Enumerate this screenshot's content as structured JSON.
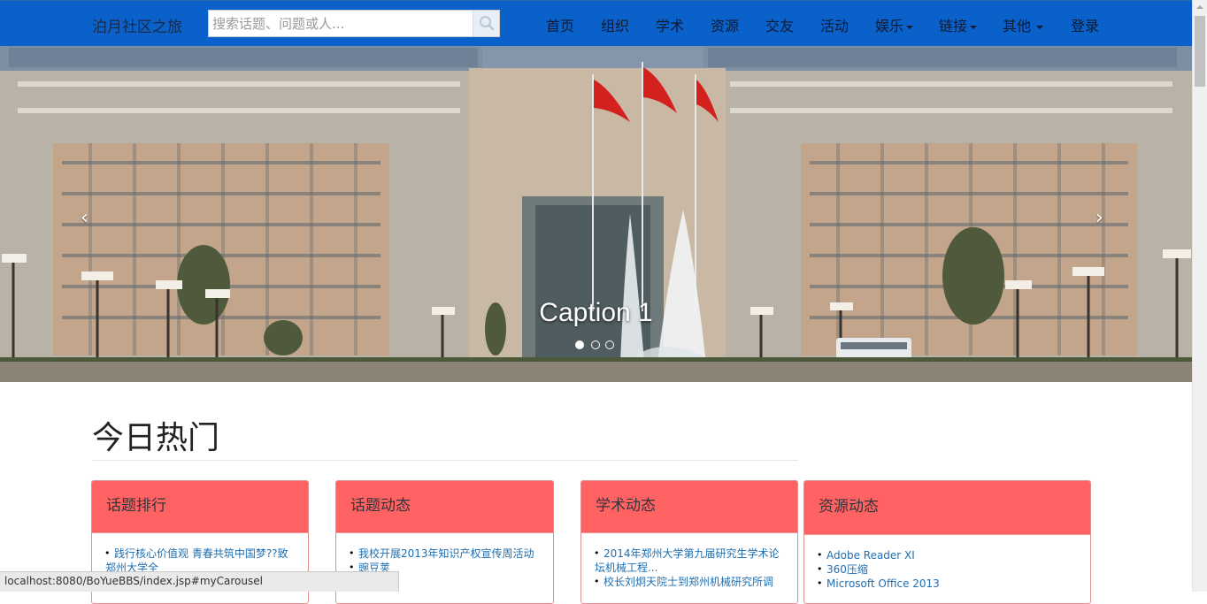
{
  "navbar": {
    "brand": "泊月社区之旅",
    "search_placeholder": "搜索话题、问题或人...",
    "items": [
      {
        "label": "首页",
        "dropdown": false
      },
      {
        "label": "组织",
        "dropdown": false
      },
      {
        "label": "学术",
        "dropdown": false
      },
      {
        "label": "资源",
        "dropdown": false
      },
      {
        "label": "交友",
        "dropdown": false
      },
      {
        "label": "活动",
        "dropdown": false
      },
      {
        "label": "娱乐",
        "dropdown": true
      },
      {
        "label": "链接",
        "dropdown": true
      },
      {
        "label": "其他",
        "dropdown": true
      },
      {
        "label": "登录",
        "dropdown": false
      }
    ]
  },
  "carousel": {
    "caption": "Caption 1",
    "prev": "‹",
    "next": "›",
    "slide_count": 3,
    "active_index": 0
  },
  "main": {
    "section_title": "今日热门",
    "panels": [
      {
        "title": "话题排行",
        "items": [
          "践行核心价值观 青春共筑中国梦??致郑州大学全"
        ]
      },
      {
        "title": "话题动态",
        "items": [
          "我校开展2013年知识产权宣传周活动",
          "豌豆荚"
        ]
      },
      {
        "title": "学术动态",
        "items": [
          "2014年郑州大学第九届研究生学术论坛机械工程...",
          "校长刘炯天院士到郑州机械研究所调"
        ]
      },
      {
        "title": "资源动态",
        "items": [
          "Adobe Reader XI",
          "360压缩",
          "Microsoft Office 2013"
        ]
      }
    ]
  },
  "statusbar": {
    "url": "localhost:8080/BoYueBBS/index.jsp#myCarousel"
  },
  "colors": {
    "navbar": "#0a61c9",
    "panel_header": "#fe6262",
    "link": "#1f6eb0"
  }
}
